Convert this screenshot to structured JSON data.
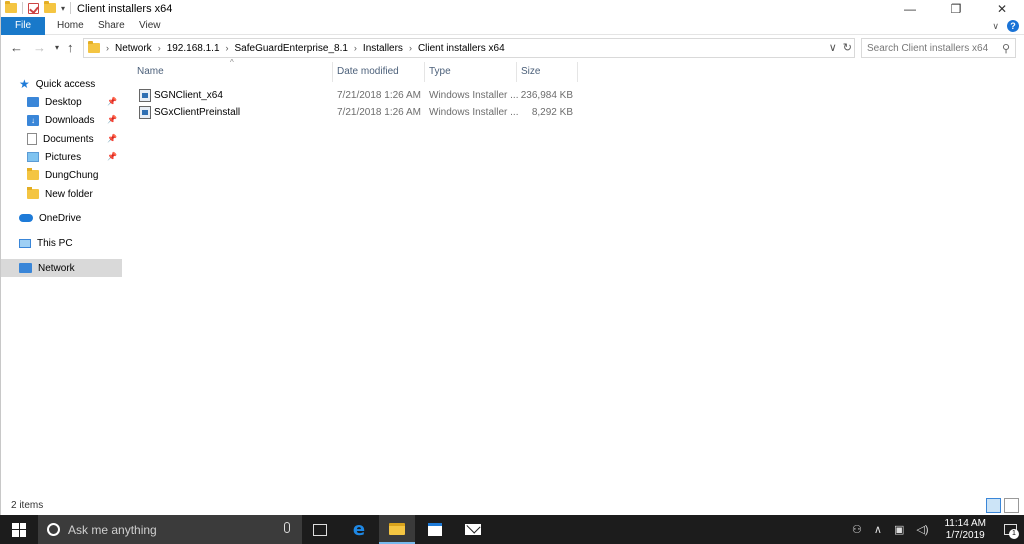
{
  "window": {
    "title": "Client installers x64",
    "controls": {
      "minimize": "—",
      "maximize": "❐",
      "close": "✕"
    }
  },
  "ribbon": {
    "tabs": [
      "File",
      "Home",
      "Share",
      "View"
    ]
  },
  "address": {
    "crumbs": [
      "Network",
      "192.168.1.1",
      "SafeGuardEnterprise_8.1",
      "Installers",
      "Client installers x64"
    ],
    "search_placeholder": "Search Client installers x64"
  },
  "nav": {
    "quick_access": "Quick access",
    "items": [
      {
        "label": "Desktop",
        "pinned": true,
        "icon": "desktop-icon"
      },
      {
        "label": "Downloads",
        "pinned": true,
        "icon": "downloads-icon"
      },
      {
        "label": "Documents",
        "pinned": true,
        "icon": "documents-icon"
      },
      {
        "label": "Pictures",
        "pinned": true,
        "icon": "pictures-icon"
      },
      {
        "label": "DungChung",
        "pinned": false,
        "icon": "folder-icon"
      },
      {
        "label": "New folder",
        "pinned": false,
        "icon": "folder-icon"
      }
    ],
    "onedrive": "OneDrive",
    "this_pc": "This PC",
    "network": "Network",
    "selected": "Network"
  },
  "columns": {
    "name": "Name",
    "date": "Date modified",
    "type": "Type",
    "size": "Size"
  },
  "files": [
    {
      "name": "SGNClient_x64",
      "date": "7/21/2018 1:26 AM",
      "type": "Windows Installer ...",
      "size": "236,984 KB"
    },
    {
      "name": "SGxClientPreinstall",
      "date": "7/21/2018 1:26 AM",
      "type": "Windows Installer ...",
      "size": "8,292 KB"
    }
  ],
  "status": {
    "items_count": "2 items"
  },
  "taskbar": {
    "search_text": "Ask me anything",
    "time": "11:14 AM",
    "date": "1/7/2019",
    "notification_count": "1"
  }
}
